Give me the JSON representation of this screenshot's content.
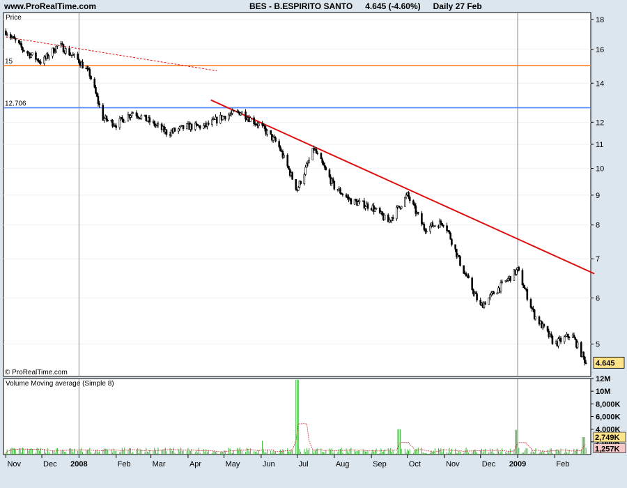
{
  "header": {
    "site": "www.ProRealTime.com",
    "title": "BES - B.ESPIRITO SANTO",
    "price": "4.645 (-4.60%)",
    "period": "Daily  27 Feb"
  },
  "price_panel": {
    "label": "Price",
    "copyright": "© ProRealTime.com",
    "last_price": "4.645",
    "hline_labels": [
      "15",
      "12.706"
    ]
  },
  "volume_panel": {
    "label": "Volume Moving average (Simple 8)",
    "last_volume": "2,749K",
    "last_ma": "1,257K"
  },
  "colors": {
    "background": "#dbe6ee",
    "plot_bg": "#ffffff",
    "candle": "#000000",
    "resistance_15": "#ff7f27",
    "support_12706": "#4f87ff",
    "trendline": "#e01010",
    "old_trendline": "#e01010",
    "volume_bar": "#3cb33c",
    "volume_ma": "#cc3333"
  },
  "chart_data": {
    "type": "line",
    "title": "BES - B.ESPIRITO SANTO",
    "y_scale": "log",
    "ylim": [
      4.4,
      18.5
    ],
    "y_ticks": [
      5,
      6,
      7,
      8,
      9,
      10,
      11,
      12,
      14,
      16,
      18
    ],
    "x_ticks": [
      "Nov",
      "Dec",
      "2008",
      "Feb",
      "Mar",
      "Apr",
      "May",
      "Jun",
      "Jul",
      "Aug",
      "Sep",
      "Oct",
      "Nov",
      "Dec",
      "2009",
      "Feb"
    ],
    "series": [
      {
        "x": [
          "2007-11-01",
          "2007-11-15",
          "2007-12-01",
          "2007-12-15",
          "2008-01-01",
          "2008-01-10",
          "2008-01-21",
          "2008-02-01",
          "2008-02-15",
          "2008-03-01",
          "2008-03-15",
          "2008-04-01",
          "2008-04-15",
          "2008-05-01",
          "2008-05-15",
          "2008-06-01",
          "2008-06-15",
          "2008-07-01",
          "2008-07-15",
          "2008-08-01",
          "2008-08-15",
          "2008-09-01",
          "2008-09-15",
          "2008-10-01",
          "2008-10-15",
          "2008-11-01",
          "2008-11-15",
          "2008-12-01",
          "2008-12-15",
          "2009-01-01",
          "2009-01-15",
          "2009-02-01",
          "2009-02-15",
          "2009-02-27"
        ],
        "values": [
          17.2,
          16.0,
          15.2,
          16.3,
          15.3,
          14.5,
          12.2,
          11.9,
          12.5,
          12.0,
          11.5,
          11.8,
          11.8,
          12.3,
          12.5,
          11.8,
          11.0,
          9.2,
          10.8,
          9.3,
          8.8,
          8.6,
          8.1,
          9.0,
          7.9,
          8.1,
          6.8,
          5.8,
          6.2,
          6.7,
          5.6,
          5.0,
          5.2,
          4.645
        ]
      }
    ],
    "horizontal_lines": [
      15,
      12.706
    ],
    "trendlines": [
      {
        "from": [
          "2007-11-01",
          16.8
        ],
        "to": [
          "2008-04-25",
          14.7
        ]
      },
      {
        "from": [
          "2008-04-20",
          13.1
        ],
        "to": [
          "2009-03-06",
          6.6
        ]
      }
    ],
    "volume": {
      "label": "Volume Moving average (Simple 8)",
      "ylim": [
        0,
        12000
      ],
      "y_ticks": [
        "12M",
        "10M",
        "8,000K",
        "6,000K",
        "4,000K",
        "2,000K"
      ],
      "last_volume_k": 2749,
      "last_ma_k": 1257,
      "spikes": [
        {
          "date": "2008-07-01",
          "value_k": 11800
        },
        {
          "date": "2008-09-24",
          "value_k": 4000
        },
        {
          "date": "2008-12-31",
          "value_k": 3900
        },
        {
          "date": "2008-06-01",
          "value_k": 2200
        },
        {
          "date": "2009-02-25",
          "value_k": 2749
        }
      ]
    }
  }
}
